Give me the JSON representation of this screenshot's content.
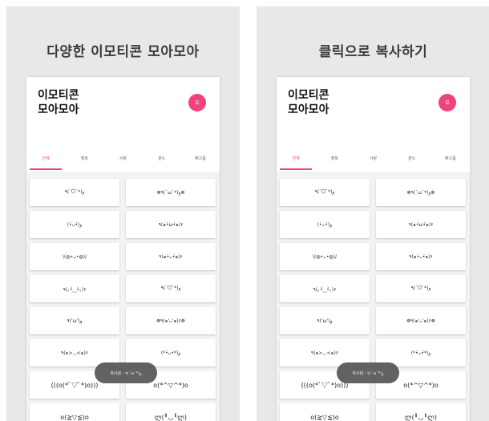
{
  "screens": [
    {
      "headline": "다양한 이모티콘 모아모아",
      "app_title": "이모티콘 모아모아",
      "menu_icon_text": "☰",
      "tabs": [
        "전체",
        "행복",
        "사랑",
        "분노",
        "배고픔"
      ],
      "active_tab": 0,
      "emoticons": [
        "٩(ˊᗜˋ*)و",
        "❁٩(ˊωˋ*)و❁",
        "(•̀ᴗ•́)و",
        "٩(๑•̀ω•́๑)۶",
        "\\(◍•ᴗ•◍)/",
        "٩(๑•̀ᴗ•́๑)۶",
        "٩(｡•́‿•̀｡)۶",
        "٩(ˊᗜˋ*)و",
        "٩('ω')و",
        "❁٩(๑'ᴗ'๑)۶❁",
        "٩(๑>◡<๑)۶",
        "(*•̀ᴗ•́*)و",
        "(((o(*ﾟ▽ﾟ*)o)))",
        "o(*^▽^*)o",
        "o(≧▽≦)o",
        "ლ(╹◡╹ლ)"
      ],
      "toast": "복사됨 : ٩(ˊωˋ*)و"
    },
    {
      "headline": "클릭으로 복사하기",
      "app_title": "이모티콘 모아모아",
      "menu_icon_text": "☰",
      "tabs": [
        "전체",
        "행복",
        "사랑",
        "분노",
        "배고픔"
      ],
      "active_tab": 0,
      "emoticons": [
        "٩(ˊᗜˋ*)و",
        "❁٩(ˊωˋ*)و❁",
        "(•̀ᴗ•́)و",
        "٩(๑•̀ω•́๑)۶",
        "\\(◍•ᴗ•◍)/",
        "٩(๑•̀ᴗ•́๑)۶",
        "٩(｡•́‿•̀｡)۶",
        "٩(ˊᗜˋ*)و",
        "٩('ω')و",
        "❁٩(๑'ᴗ'๑)۶❁",
        "٩(๑>◡<๑)۶",
        "(*•̀ᴗ•́*)و",
        "(((o(*ﾟ▽ﾟ*)o)))",
        "o(*^▽^*)o",
        "o(≧▽≦)o",
        "ლ(╹◡╹ლ)"
      ],
      "toast": "복사됨 : ٩(ˊωˋ*)و"
    }
  ],
  "colors": {
    "accent": "#f0437a",
    "panel_bg": "#e8e8ea",
    "toast_bg": "#555555"
  }
}
